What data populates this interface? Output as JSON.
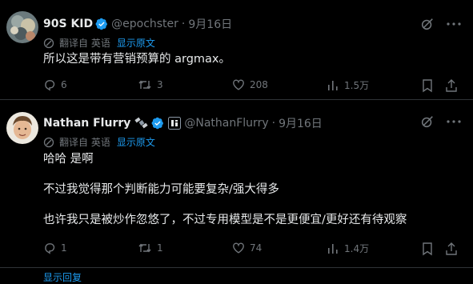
{
  "tweets": [
    {
      "display_name": "90S KID",
      "handle": "@epochster",
      "date": "9月16日",
      "translated_from": "翻译自 英语",
      "show_original": "显示原文",
      "text_lines": [
        "所以这是带有营销预算的 argmax。"
      ],
      "replies": "6",
      "retweets": "3",
      "likes": "208",
      "views": "1.5万"
    },
    {
      "display_name": "Nathan Flurry",
      "handle": "@NathanFlurry",
      "date": "9月16日",
      "translated_from": "翻译自 英语",
      "show_original": "显示原文",
      "text_lines": [
        "哈哈 是啊",
        "不过我觉得那个判断能力可能要复杂/强大得多",
        "也许我只是被炒作忽悠了，不过专用模型是不是更便宜/更好还有待观察"
      ],
      "replies": "1",
      "retweets": "1",
      "likes": "74",
      "views": "1.4万"
    }
  ],
  "footer_partial": "显示回复",
  "colors": {
    "accent": "#1d9bf0",
    "muted": "#71767b",
    "text": "#e7e9ea",
    "divider": "#2f3336",
    "background": "#000000"
  },
  "icons": [
    "grok-icon",
    "more-icon",
    "translate-icon",
    "reply-icon",
    "retweet-icon",
    "like-icon",
    "views-icon",
    "bookmark-icon",
    "share-icon",
    "verified-badge-icon",
    "satellite-emoji-icon",
    "affiliate-badge-icon"
  ]
}
